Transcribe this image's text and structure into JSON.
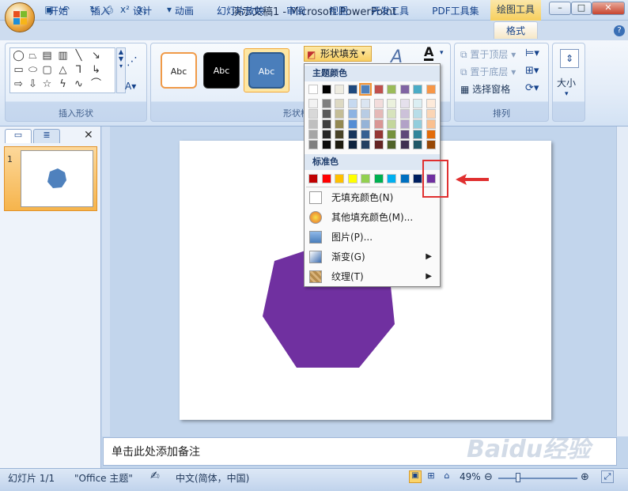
{
  "window": {
    "title": "演示文稿1 - Microsoft PowerPoint",
    "context_tools": "绘图工具",
    "min_label": "–",
    "max_label": "□",
    "close_label": "✕"
  },
  "tabs": [
    "开始",
    "插入",
    "设计",
    "动画",
    "幻灯片放映",
    "审阅",
    "视图",
    "开发工具",
    "PDF工具集",
    "格式"
  ],
  "ribbon": {
    "insert_shapes_label": "插入形状",
    "shape_styles_label": "形状样式",
    "arrange_label": "排列",
    "style_abc": [
      "Abc",
      "Abc",
      "Abc"
    ],
    "fill_button": "形状填充",
    "bring_front": "置于顶层",
    "send_back": "置于底层",
    "selection_pane": "选择窗格",
    "size_label": "大小"
  },
  "dropdown": {
    "theme_colors_header": "主题颜色",
    "standard_colors_header": "标准色",
    "theme_top_row": [
      "#ffffff",
      "#000000",
      "#eeece1",
      "#1f497d",
      "#4f81bd",
      "#c0504d",
      "#9bbb59",
      "#8064a2",
      "#4bacc6",
      "#f79646"
    ],
    "theme_shades": [
      [
        "#f2f2f2",
        "#7f7f7f",
        "#ddd9c3",
        "#c6d9f0",
        "#dbe5f1",
        "#f2dcdb",
        "#ebf1dd",
        "#e5e0ec",
        "#dbeef3",
        "#fdeada"
      ],
      [
        "#d8d8d8",
        "#595959",
        "#c4bd97",
        "#8db3e2",
        "#b8cce4",
        "#e5b9b7",
        "#d7e3bc",
        "#ccc1d9",
        "#b7dde8",
        "#fbd5b5"
      ],
      [
        "#bfbfbf",
        "#3f3f3f",
        "#938953",
        "#548dd4",
        "#95b3d7",
        "#d99694",
        "#c3d69b",
        "#b2a2c7",
        "#92cddc",
        "#fac08f"
      ],
      [
        "#a5a5a5",
        "#262626",
        "#494429",
        "#17365d",
        "#366092",
        "#953734",
        "#76923c",
        "#5f497a",
        "#31859b",
        "#e36c09"
      ],
      [
        "#7f7f7f",
        "#0c0c0c",
        "#1d1b10",
        "#0f243e",
        "#244061",
        "#632423",
        "#4f6128",
        "#3f3151",
        "#205867",
        "#974806"
      ]
    ],
    "standard_colors": [
      "#c00000",
      "#ff0000",
      "#ffc000",
      "#ffff00",
      "#92d050",
      "#00b050",
      "#00b0f0",
      "#0070c0",
      "#002060",
      "#7030a0"
    ],
    "no_fill": "无填充颜色(N)",
    "more_colors": "其他填充颜色(M)...",
    "picture": "图片(P)...",
    "gradient": "渐变(G)",
    "texture": "纹理(T)"
  },
  "slide_panel": {
    "slide_number": "1"
  },
  "notes": {
    "placeholder": "单击此处添加备注"
  },
  "status": {
    "slide_info": "幻灯片 1/1",
    "theme": "\"Office 主题\"",
    "language": "中文(简体，中国)",
    "zoom": "49%"
  },
  "watermark": "Baidu经验",
  "colors": {
    "shape_fill": "#7030a0",
    "highlight": "#e03030",
    "ribbon_bg": "#dfe9f6"
  }
}
